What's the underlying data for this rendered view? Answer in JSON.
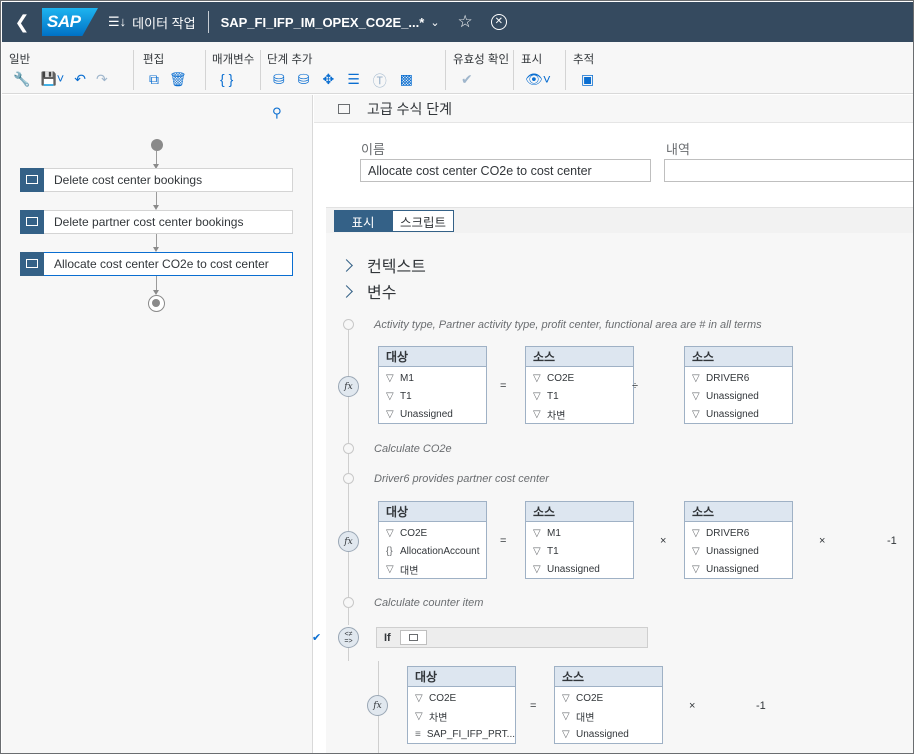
{
  "shell": {
    "app_name": "데이터 작업",
    "doc_title": "SAP_FI_IFP_IM_OPEX_CO2E_...*"
  },
  "toolbar": {
    "groups": [
      {
        "label": "일반",
        "icons": [
          "wrench-icon",
          "save-icon",
          "undo-icon",
          "redo-icon"
        ]
      },
      {
        "label": "편집",
        "icons": [
          "copy-icon",
          "delete-icon"
        ]
      },
      {
        "label": "매개변수",
        "icons": [
          "braces-icon"
        ]
      },
      {
        "label": "단계 추가",
        "icons": [
          "database-step-icon",
          "database-icon",
          "move-icon",
          "sort-step-icon",
          "currency-icon",
          "script-step-icon"
        ]
      },
      {
        "label": "유효성 확인",
        "icons": [
          "validate-icon"
        ]
      },
      {
        "label": "표시",
        "icons": [
          "view-icon"
        ]
      },
      {
        "label": "추적",
        "icons": [
          "trace-icon"
        ]
      }
    ]
  },
  "steps": [
    {
      "label": "Delete cost center bookings"
    },
    {
      "label": "Delete partner cost center bookings"
    },
    {
      "label": "Allocate cost center CO2e to cost center"
    }
  ],
  "detail": {
    "header_title": "고급 수식 단계",
    "name_label": "이름",
    "name_value": "Allocate cost center CO2e to cost center",
    "desc_label": "내역",
    "desc_value": "",
    "tabs": [
      "표시",
      "스크립트"
    ],
    "expanders": [
      "컨텍스트",
      "변수"
    ],
    "comments": [
      "Activity type, Partner activity type, profit center, functional area are # in all terms",
      "Calculate CO2e",
      "Driver6 provides partner cost center",
      "Calculate counter item"
    ],
    "formulas": [
      {
        "target": {
          "title": "대상",
          "rows": [
            "M1",
            "T1",
            "Unassigned"
          ]
        },
        "source1": {
          "title": "소스",
          "rows": [
            "CO2E",
            "T1",
            "차변"
          ]
        },
        "source2": {
          "title": "소스",
          "rows": [
            "DRIVER6",
            "Unassigned",
            "Unassigned"
          ]
        },
        "eq": "=",
        "op": "÷",
        "trail_op": "",
        "trail_val": ""
      },
      {
        "target": {
          "title": "대상",
          "rows": [
            "CO2E",
            "AllocationAccount",
            "대변"
          ]
        },
        "source1": {
          "title": "소스",
          "rows": [
            "M1",
            "T1",
            "Unassigned"
          ]
        },
        "source2": {
          "title": "소스",
          "rows": [
            "DRIVER6",
            "Unassigned",
            "Unassigned"
          ]
        },
        "eq": "=",
        "op": "×",
        "trail_op": "×",
        "trail_val": "-1"
      },
      {
        "target": {
          "title": "대상",
          "rows": [
            "CO2E",
            "차변",
            "SAP_FI_IFP_PRT..."
          ]
        },
        "source1": {
          "title": "소스",
          "rows": [
            "CO2E",
            "대변",
            "Unassigned"
          ]
        },
        "eq": "=",
        "op": "×",
        "trail_val": "-1"
      }
    ],
    "if_label": "If"
  }
}
